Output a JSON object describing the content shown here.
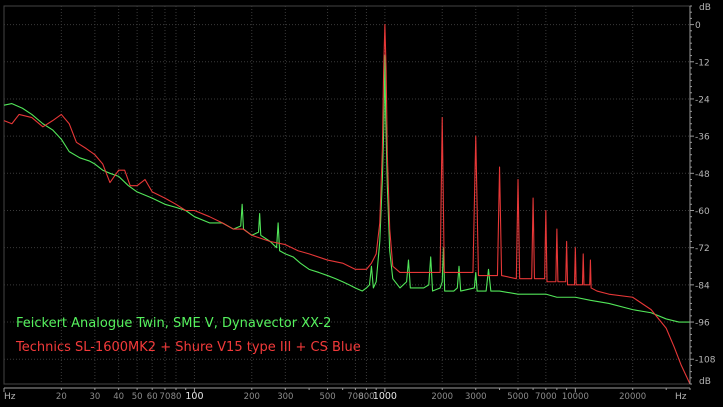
{
  "colors": {
    "background": "#000000",
    "plot_background": "#000000",
    "grid": "#3a3a3a",
    "axis_text": "#b4b4b4",
    "series_green": "#56f25e",
    "series_red": "#f23a3a",
    "ruler": "#9a9a9a"
  },
  "chart_data": {
    "type": "line",
    "title": "",
    "xscale": "log",
    "xunit_label_left": "Hz",
    "xunit_label_right": "Hz",
    "yunit_label_top": "dB",
    "yunit_label_bottom": "dB",
    "xlim": [
      10,
      40000
    ],
    "ylim": [
      -116,
      6
    ],
    "xticks": [
      {
        "value": 20,
        "label": "20",
        "major": false
      },
      {
        "value": 30,
        "label": "30",
        "major": false
      },
      {
        "value": 40,
        "label": "40",
        "major": false
      },
      {
        "value": 50,
        "label": "50",
        "major": false
      },
      {
        "value": 60,
        "label": "60",
        "major": false
      },
      {
        "value": 70,
        "label": "70",
        "major": false
      },
      {
        "value": 80,
        "label": "80",
        "major": false
      },
      {
        "value": 100,
        "label": "100",
        "major": true
      },
      {
        "value": 200,
        "label": "200",
        "major": false
      },
      {
        "value": 300,
        "label": "300",
        "major": false
      },
      {
        "value": 500,
        "label": "500",
        "major": false
      },
      {
        "value": 700,
        "label": "700",
        "major": false
      },
      {
        "value": 800,
        "label": "800",
        "major": false
      },
      {
        "value": 1000,
        "label": "1000",
        "major": true
      },
      {
        "value": 2000,
        "label": "2000",
        "major": false
      },
      {
        "value": 3000,
        "label": "3000",
        "major": false
      },
      {
        "value": 5000,
        "label": "5000",
        "major": false
      },
      {
        "value": 7000,
        "label": "7000",
        "major": false
      },
      {
        "value": 10000,
        "label": "10000",
        "major": false
      },
      {
        "value": 20000,
        "label": "20000",
        "major": false
      }
    ],
    "yticks": [
      0,
      -12,
      -24,
      -36,
      -48,
      -60,
      -72,
      -84,
      -96,
      -108
    ],
    "grid": true,
    "legend_position": "bottom-left",
    "legend": [
      {
        "label": "Feickert Analogue Twin, SME V, Dynavector XX-2",
        "color_key": "series_green"
      },
      {
        "label": "Technics SL-1600MK2 + Shure V15 type III + CS Blue",
        "color_key": "series_red"
      }
    ],
    "series": [
      {
        "name": "Feickert Analogue Twin, SME V, Dynavector XX-2",
        "color_key": "series_green",
        "points": [
          [
            10,
            -26
          ],
          [
            11,
            -25.5
          ],
          [
            12.5,
            -27
          ],
          [
            14,
            -29
          ],
          [
            16,
            -32
          ],
          [
            18,
            -34
          ],
          [
            20,
            -37
          ],
          [
            22,
            -41
          ],
          [
            25,
            -43
          ],
          [
            28,
            -44
          ],
          [
            30,
            -45
          ],
          [
            33,
            -47
          ],
          [
            36,
            -48
          ],
          [
            40,
            -49
          ],
          [
            45,
            -52
          ],
          [
            50,
            -54
          ],
          [
            60,
            -56
          ],
          [
            70,
            -58
          ],
          [
            80,
            -59
          ],
          [
            90,
            -60
          ],
          [
            100,
            -62
          ],
          [
            120,
            -64
          ],
          [
            140,
            -64
          ],
          [
            160,
            -66
          ],
          [
            175,
            -65
          ],
          [
            178,
            -58
          ],
          [
            181,
            -66
          ],
          [
            200,
            -68
          ],
          [
            217,
            -67
          ],
          [
            220,
            -61
          ],
          [
            223,
            -68
          ],
          [
            250,
            -70
          ],
          [
            270,
            -72
          ],
          [
            275,
            -64
          ],
          [
            280,
            -73
          ],
          [
            300,
            -74
          ],
          [
            330,
            -75
          ],
          [
            360,
            -77
          ],
          [
            400,
            -79
          ],
          [
            450,
            -80
          ],
          [
            500,
            -81
          ],
          [
            550,
            -82
          ],
          [
            600,
            -83
          ],
          [
            650,
            -84
          ],
          [
            700,
            -85
          ],
          [
            760,
            -86
          ],
          [
            800,
            -85
          ],
          [
            830,
            -84
          ],
          [
            850,
            -78
          ],
          [
            870,
            -85
          ],
          [
            900,
            -83
          ],
          [
            940,
            -70
          ],
          [
            970,
            -50
          ],
          [
            990,
            -30
          ],
          [
            1000,
            -10
          ],
          [
            1010,
            -30
          ],
          [
            1030,
            -52
          ],
          [
            1060,
            -73
          ],
          [
            1100,
            -82
          ],
          [
            1200,
            -85
          ],
          [
            1300,
            -83
          ],
          [
            1330,
            -76
          ],
          [
            1360,
            -85
          ],
          [
            1600,
            -85
          ],
          [
            1700,
            -84
          ],
          [
            1740,
            -75
          ],
          [
            1780,
            -86
          ],
          [
            1950,
            -85
          ],
          [
            2000,
            -83
          ],
          [
            2030,
            -72
          ],
          [
            2060,
            -86
          ],
          [
            2300,
            -86
          ],
          [
            2400,
            -85
          ],
          [
            2450,
            -78
          ],
          [
            2500,
            -86
          ],
          [
            2950,
            -85
          ],
          [
            3000,
            -80
          ],
          [
            3050,
            -86
          ],
          [
            3400,
            -86
          ],
          [
            3500,
            -79
          ],
          [
            3600,
            -86
          ],
          [
            4000,
            -86
          ],
          [
            5000,
            -87
          ],
          [
            6000,
            -87
          ],
          [
            7000,
            -87
          ],
          [
            8000,
            -88
          ],
          [
            10000,
            -88
          ],
          [
            12000,
            -89
          ],
          [
            15000,
            -90
          ],
          [
            20000,
            -92
          ],
          [
            25000,
            -93
          ],
          [
            30000,
            -95
          ],
          [
            35000,
            -96
          ],
          [
            40000,
            -96
          ]
        ]
      },
      {
        "name": "Technics SL-1600MK2 + Shure V15 type III + CS Blue",
        "color_key": "series_red",
        "points": [
          [
            10,
            -31
          ],
          [
            11,
            -32
          ],
          [
            12,
            -29
          ],
          [
            14,
            -30
          ],
          [
            16,
            -33
          ],
          [
            18,
            -31
          ],
          [
            20,
            -29
          ],
          [
            22,
            -32
          ],
          [
            24,
            -38
          ],
          [
            27,
            -40
          ],
          [
            30,
            -42
          ],
          [
            33,
            -45
          ],
          [
            36,
            -51
          ],
          [
            40,
            -47
          ],
          [
            43,
            -47
          ],
          [
            46,
            -52
          ],
          [
            50,
            -52
          ],
          [
            55,
            -50
          ],
          [
            60,
            -54
          ],
          [
            70,
            -56
          ],
          [
            80,
            -58
          ],
          [
            90,
            -60
          ],
          [
            100,
            -60
          ],
          [
            120,
            -62
          ],
          [
            140,
            -64
          ],
          [
            160,
            -66
          ],
          [
            180,
            -66
          ],
          [
            200,
            -68
          ],
          [
            250,
            -70
          ],
          [
            300,
            -71
          ],
          [
            350,
            -73
          ],
          [
            400,
            -74
          ],
          [
            500,
            -76
          ],
          [
            600,
            -77
          ],
          [
            700,
            -79
          ],
          [
            800,
            -79
          ],
          [
            850,
            -77
          ],
          [
            900,
            -74
          ],
          [
            940,
            -64
          ],
          [
            970,
            -40
          ],
          [
            985,
            -15
          ],
          [
            1000,
            0
          ],
          [
            1015,
            -15
          ],
          [
            1030,
            -42
          ],
          [
            1060,
            -66
          ],
          [
            1100,
            -78
          ],
          [
            1200,
            -80
          ],
          [
            1500,
            -80
          ],
          [
            1800,
            -80
          ],
          [
            1950,
            -80
          ],
          [
            2000,
            -30
          ],
          [
            2050,
            -80
          ],
          [
            2900,
            -80
          ],
          [
            3000,
            -36
          ],
          [
            3100,
            -81
          ],
          [
            3900,
            -81
          ],
          [
            4000,
            -46
          ],
          [
            4100,
            -81
          ],
          [
            4900,
            -82
          ],
          [
            5000,
            -50
          ],
          [
            5100,
            -82
          ],
          [
            5900,
            -82
          ],
          [
            6000,
            -56
          ],
          [
            6100,
            -82
          ],
          [
            6900,
            -82
          ],
          [
            7000,
            -60
          ],
          [
            7100,
            -83
          ],
          [
            7900,
            -83
          ],
          [
            8000,
            -66
          ],
          [
            8100,
            -83
          ],
          [
            8900,
            -83
          ],
          [
            9000,
            -70
          ],
          [
            9100,
            -84
          ],
          [
            9900,
            -84
          ],
          [
            10000,
            -72
          ],
          [
            10100,
            -84
          ],
          [
            10900,
            -84
          ],
          [
            11000,
            -74
          ],
          [
            11100,
            -84
          ],
          [
            11900,
            -84
          ],
          [
            12000,
            -76
          ],
          [
            12100,
            -85
          ],
          [
            13000,
            -86
          ],
          [
            15000,
            -87
          ],
          [
            20000,
            -88
          ],
          [
            25000,
            -92
          ],
          [
            30000,
            -98
          ],
          [
            33000,
            -104
          ],
          [
            36000,
            -110
          ],
          [
            40000,
            -116
          ]
        ]
      }
    ]
  }
}
